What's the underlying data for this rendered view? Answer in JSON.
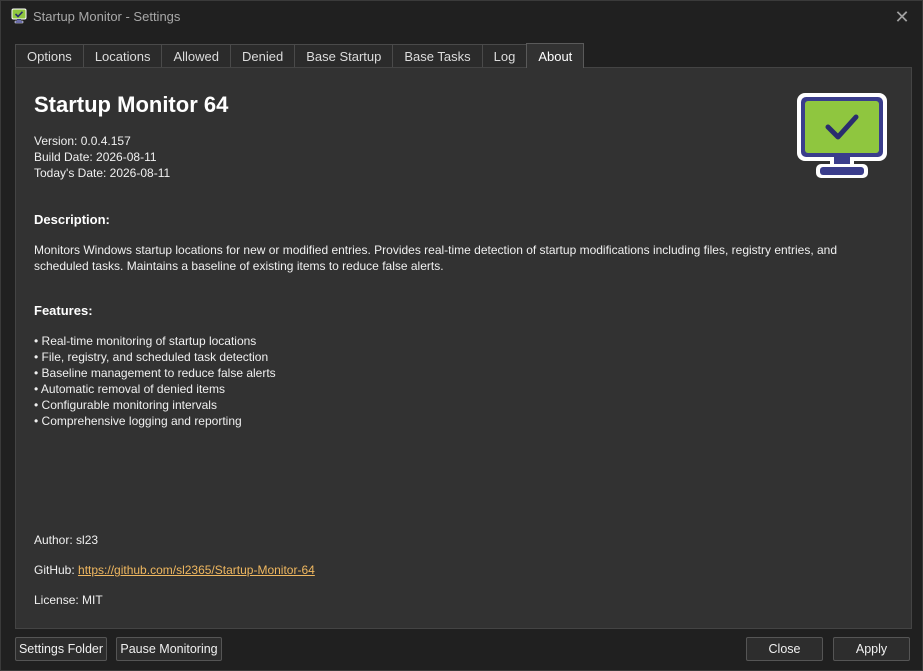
{
  "window": {
    "title": "Startup Monitor - Settings"
  },
  "tabs": [
    {
      "label": "Options"
    },
    {
      "label": "Locations"
    },
    {
      "label": "Allowed"
    },
    {
      "label": "Denied"
    },
    {
      "label": "Base Startup"
    },
    {
      "label": "Base Tasks"
    },
    {
      "label": "Log"
    },
    {
      "label": "About",
      "active": true
    }
  ],
  "about": {
    "title": "Startup Monitor 64",
    "version": "Version: 0.0.4.157",
    "build_date": "Build Date: 2026-08-11",
    "todays_date": "Today's Date: 2026-08-11",
    "description_heading": "Description:",
    "description": "Monitors Windows startup locations for new or modified entries. Provides real-time detection of startup modifications including files, registry entries, and scheduled tasks. Maintains a baseline of existing items to reduce false alerts.",
    "features_heading": "Features:",
    "features": [
      "Real-time monitoring of startup locations",
      "File, registry, and scheduled task detection",
      "Baseline management to reduce false alerts",
      "Automatic removal of denied items",
      "Configurable monitoring intervals",
      "Comprehensive logging and reporting"
    ],
    "author": "Author: sl23",
    "github_label": "GitHub: ",
    "github_url": "https://github.com/sl2365/Startup-Monitor-64",
    "license": "License: MIT",
    "logo_icon": "monitor-checkmark-icon"
  },
  "buttons": {
    "settings_folder": "Settings Folder",
    "pause_monitoring": "Pause Monitoring",
    "close": "Close",
    "apply": "Apply"
  },
  "colors": {
    "accent_green": "#8fc63f",
    "logo_navy": "#3a3d8c",
    "link": "#f0b860"
  }
}
